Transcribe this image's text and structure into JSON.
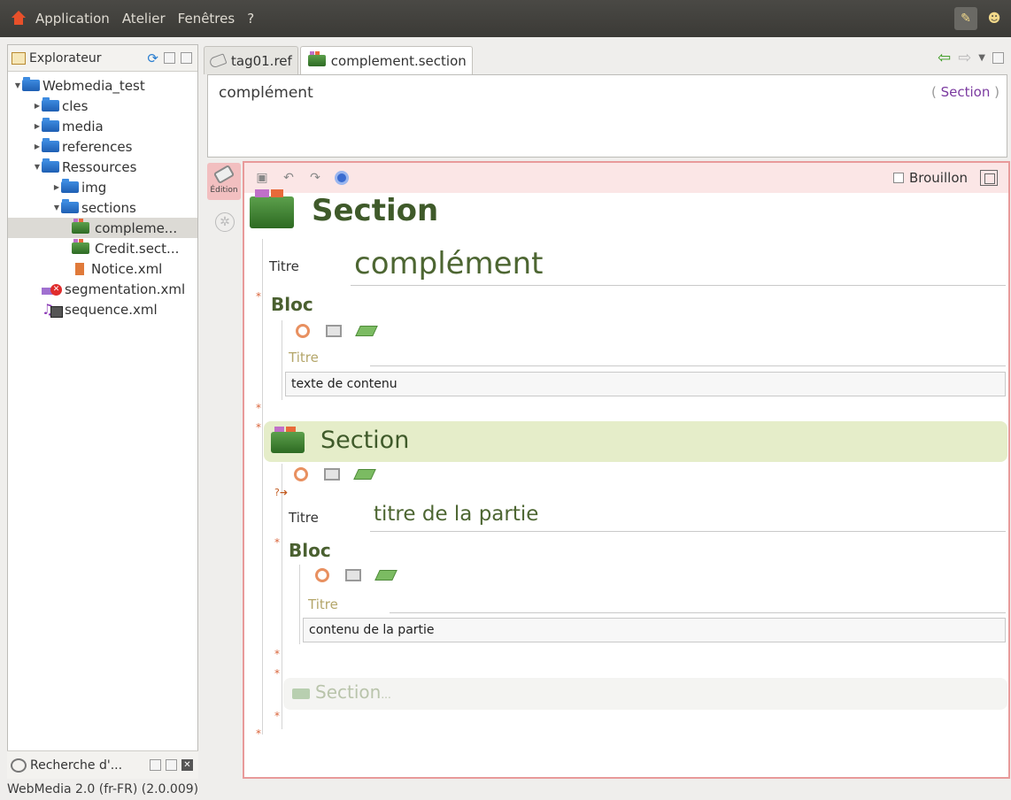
{
  "menubar": {
    "items": [
      "Application",
      "Atelier",
      "Fenêtres",
      "?"
    ]
  },
  "explorer": {
    "title": "Explorateur",
    "tree": [
      {
        "label": "Webmedia_test",
        "type": "folder",
        "expanded": true,
        "level": 0
      },
      {
        "label": "cles",
        "type": "folder",
        "expanded": false,
        "level": 1
      },
      {
        "label": "media",
        "type": "folder",
        "expanded": false,
        "level": 1
      },
      {
        "label": "references",
        "type": "folder",
        "expanded": false,
        "level": 1
      },
      {
        "label": "Ressources",
        "type": "folder",
        "expanded": true,
        "level": 1
      },
      {
        "label": "img",
        "type": "folder",
        "expanded": false,
        "level": 2
      },
      {
        "label": "sections",
        "type": "folder",
        "expanded": true,
        "level": 2
      },
      {
        "label": "compleme...",
        "type": "section",
        "selected": true,
        "level": 3
      },
      {
        "label": "Credit.sect...",
        "type": "section",
        "level": 3
      },
      {
        "label": "Notice.xml",
        "type": "xml",
        "level": 3
      },
      {
        "label": "segmentation.xml",
        "type": "segmentation",
        "level": 1
      },
      {
        "label": "sequence.xml",
        "type": "sequence",
        "level": 1
      }
    ]
  },
  "recherche": {
    "title": "Recherche d'..."
  },
  "tabs": [
    {
      "label": "tag01.ref",
      "icon": "ref-icon",
      "active": false
    },
    {
      "label": "complement.section",
      "icon": "section-icon",
      "active": true
    }
  ],
  "header": {
    "name": "complément",
    "type_open": "(",
    "type": "Section",
    "type_close": ")"
  },
  "sidebar": {
    "edition_label": "Édition"
  },
  "toolbar": {
    "brouillon_label": "Brouillon"
  },
  "document": {
    "section_title": "Section",
    "titre_label": "Titre",
    "titre_value": "complément",
    "bloc1": {
      "label": "Bloc",
      "titre_label": "Titre",
      "content": "texte de contenu"
    },
    "subsection": {
      "title": "Section",
      "titre_label": "Titre",
      "titre_value": "titre de la partie",
      "bloc": {
        "label": "Bloc",
        "titre_label": "Titre",
        "content": "contenu de la partie"
      }
    },
    "placeholder": {
      "title": "Section",
      "ellipsis": "..."
    }
  },
  "status": {
    "text": "WebMedia 2.0 (fr-FR) (2.0.009)"
  },
  "colors": {
    "accent_red_border": "#e89a9a",
    "section_green": "#4d6632",
    "type_purple": "#7b3aa0",
    "subsection_bg": "#e5edc9"
  }
}
